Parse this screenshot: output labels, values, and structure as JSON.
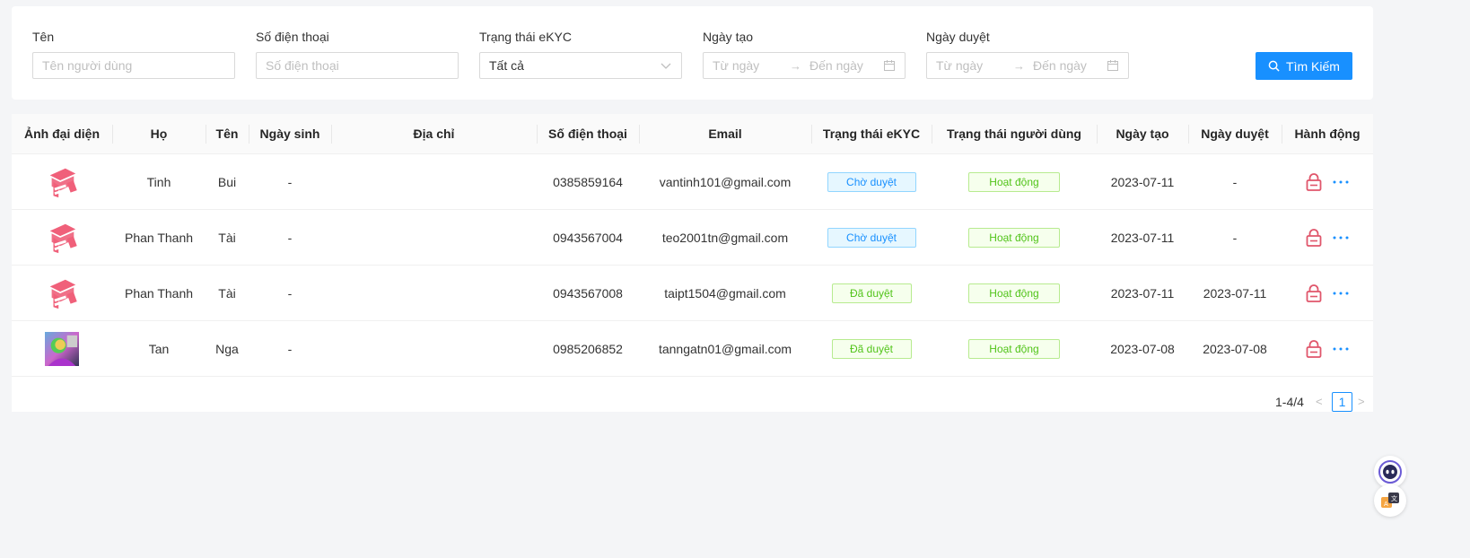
{
  "filters": {
    "name": {
      "label": "Tên",
      "placeholder": "Tên người dùng"
    },
    "phone": {
      "label": "Số điện thoại",
      "placeholder": "Số điện thoại"
    },
    "ekyc": {
      "label": "Trạng thái eKYC",
      "value": "Tất cả"
    },
    "created": {
      "label": "Ngày tạo",
      "from": "Từ ngày",
      "to": "Đến ngày"
    },
    "approved": {
      "label": "Ngày duyệt",
      "from": "Từ ngày",
      "to": "Đến ngày"
    },
    "search_label": "Tìm Kiếm"
  },
  "table": {
    "columns": [
      "Ảnh đại diện",
      "Họ",
      "Tên",
      "Ngày sinh",
      "Địa chỉ",
      "Số điện thoại",
      "Email",
      "Trạng thái eKYC",
      "Trạng thái người dùng",
      "Ngày tạo",
      "Ngày duyệt",
      "Hành động"
    ],
    "rows": [
      {
        "avatar": "hat-logo",
        "last_name": "Tinh",
        "first_name": "Bui",
        "dob": "-",
        "address": "",
        "phone": "0385859164",
        "email": "vantinh101@gmail.com",
        "ekyc": "Chờ duyệt",
        "status": "Hoạt động",
        "created": "2023-07-11",
        "approved": "-"
      },
      {
        "avatar": "hat-logo",
        "last_name": "Phan Thanh",
        "first_name": "Tài",
        "dob": "-",
        "address": "",
        "phone": "0943567004",
        "email": "teo2001tn@gmail.com",
        "ekyc": "Chờ duyệt",
        "status": "Hoạt động",
        "created": "2023-07-11",
        "approved": "-"
      },
      {
        "avatar": "hat-logo",
        "last_name": "Phan Thanh",
        "first_name": "Tài",
        "dob": "-",
        "address": "",
        "phone": "0943567008",
        "email": "taipt1504@gmail.com",
        "ekyc": "Đã duyệt",
        "status": "Hoạt động",
        "created": "2023-07-11",
        "approved": "2023-07-11"
      },
      {
        "avatar": "photo",
        "last_name": "Tan",
        "first_name": "Nga",
        "dob": "-",
        "address": "",
        "phone": "0985206852",
        "email": "tanngatn01@gmail.com",
        "ekyc": "Đã duyệt",
        "status": "Hoạt động",
        "created": "2023-07-08",
        "approved": "2023-07-08"
      }
    ]
  },
  "pagination": {
    "range": "1-4/4",
    "current": "1"
  },
  "colors": {
    "primary": "#1890ff",
    "success": "#52c41a",
    "danger": "#e0566b",
    "avatar_pink": "#f0607a"
  }
}
